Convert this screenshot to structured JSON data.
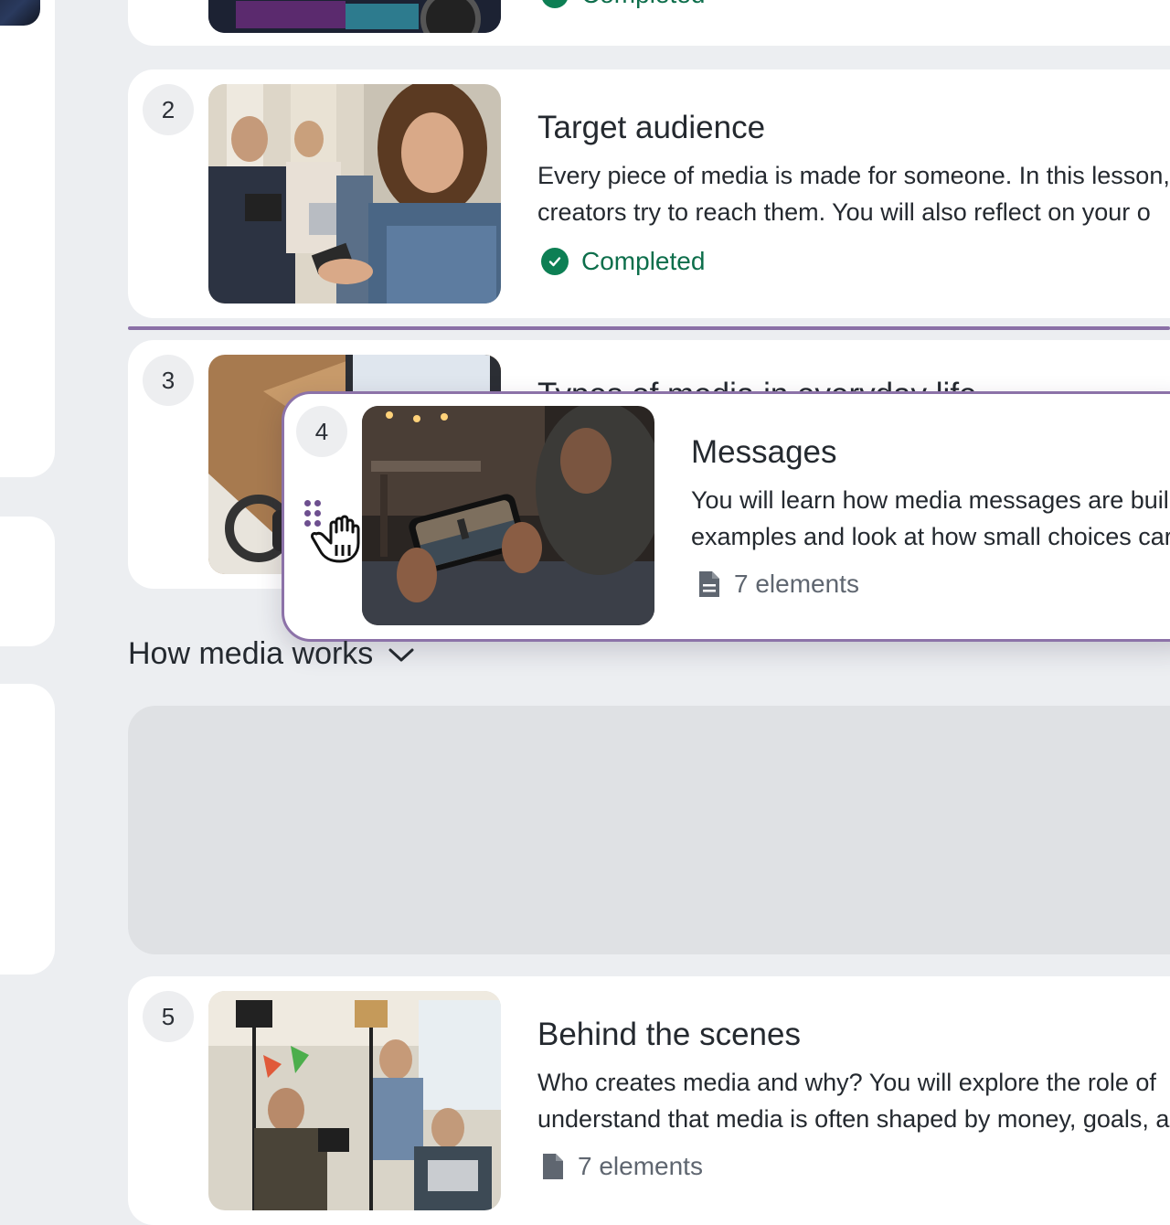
{
  "lessons": [
    {
      "number": "2",
      "title": "Target audience",
      "desc1": "Every piece of media is made for someone. In this lesson,",
      "desc2": "creators try to reach them. You will also reflect on your o",
      "status": "Completed"
    },
    {
      "number": "3",
      "title": "Types of media in everyday life"
    },
    {
      "number": "4",
      "title": "Messages",
      "desc1": "You will learn how media messages are buil",
      "desc2": "examples and look at how small choices car",
      "meta": "7 elements"
    },
    {
      "number": "5",
      "title": "Behind the scenes",
      "desc1": "Who creates media and why? You will explore the role of",
      "desc2": "understand that media is often shaped by money, goals, a",
      "meta": "7 elements"
    }
  ],
  "top_partial": {
    "status": "Completed"
  },
  "section": {
    "title": "How media works"
  },
  "icons": {
    "status_done": "check-circle-icon",
    "meta": "document-icon",
    "section_toggle": "chevron-down-icon",
    "drag": "drag-handle-icon",
    "cursor": "grabbing-hand-icon"
  },
  "colors": {
    "completed": "#0d7f54",
    "drag_accent": "#8c72a8",
    "background": "#eceef1"
  }
}
